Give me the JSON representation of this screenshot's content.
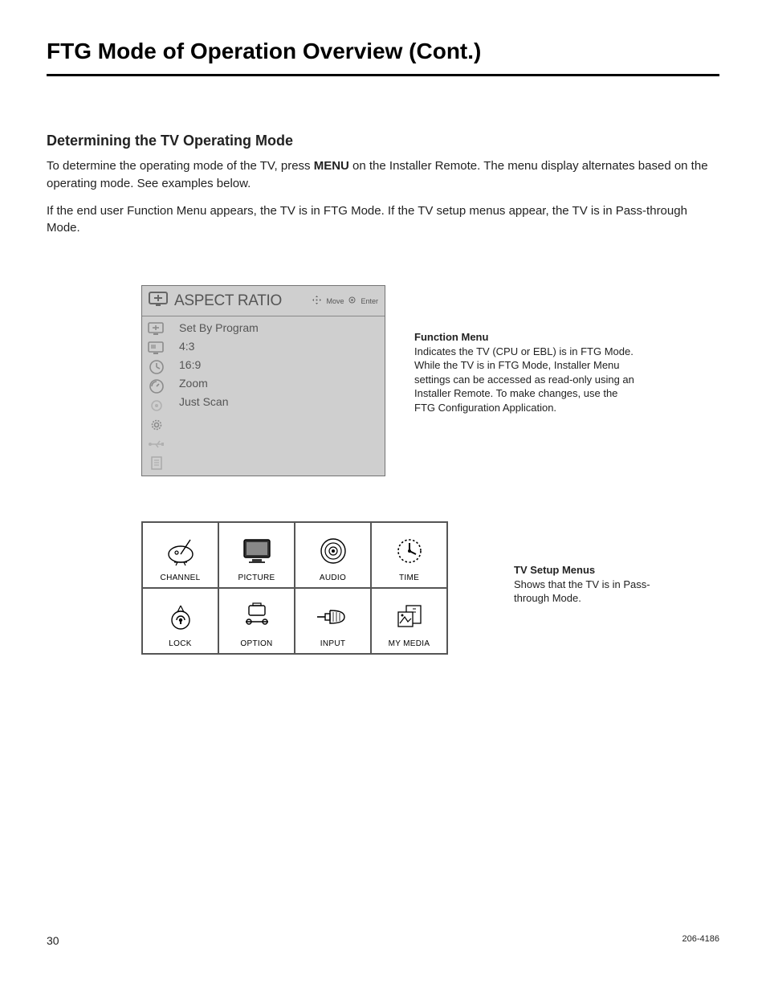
{
  "title": "FTG Mode of Operation Overview (Cont.)",
  "section_heading": "Determining the TV Operating Mode",
  "para1_a": "To determine the operating mode of the TV, press ",
  "para1_menu": "MENU",
  "para1_b": " on the Installer Remote. The menu display alternates based on the operating mode. See examples below.",
  "para2": "If the end user Function Menu appears, the TV is in FTG Mode. If the TV setup menus appear, the TV is in Pass-through Mode.",
  "function_menu": {
    "title": "ASPECT RATIO",
    "hint_move": "Move",
    "hint_enter": "Enter",
    "items": {
      "0": "Set By Program",
      "1": "4:3",
      "2": "16:9",
      "3": "Zoom",
      "4": "Just Scan"
    }
  },
  "callout1": {
    "title": "Function Menu",
    "body": "Indicates the TV (CPU or EBL) is in FTG Mode. While the TV is in FTG Mode, Installer Menu settings can be accessed as read-only using an Installer Remote. To make changes, use the FTG Configuration Application."
  },
  "setup_menus": {
    "r0c0": "CHANNEL",
    "r0c1": "PICTURE",
    "r0c2": "AUDIO",
    "r0c3": "TIME",
    "r1c0": "LOCK",
    "r1c1": "OPTION",
    "r1c2": "INPUT",
    "r1c3": "MY MEDIA"
  },
  "callout2": {
    "title": "TV Setup Menus",
    "body": "Shows that the TV is in Pass-through Mode."
  },
  "footer": {
    "page": "30",
    "doc": "206-4186"
  }
}
